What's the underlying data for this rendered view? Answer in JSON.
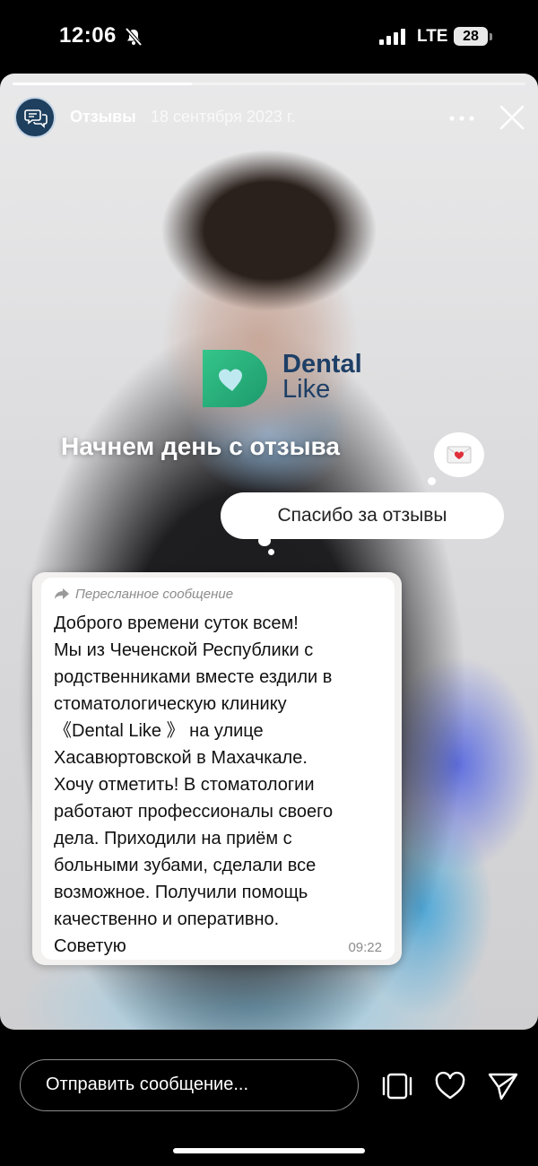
{
  "status_bar": {
    "time": "12:06",
    "network": "LTE",
    "battery": "28"
  },
  "story": {
    "progress": 0.35,
    "account": "Отзывы",
    "date": "18 сентября 2023 г.",
    "logo": {
      "line1": "Dental",
      "line2": "Like",
      "color": "#1e3f66",
      "mark_color": "#2fb37f"
    },
    "headline": "Начнем день с отзыва",
    "thanks_bubble": "Спасибо за отзывы",
    "message": {
      "forwarded_label": "Пересланное сообщение",
      "lines": [
        "Доброго времени суток всем!",
        "Мы из Чеченской Республики с",
        "родственниками вместе ездили в",
        "стоматологическую клинику",
        "《Dental Like 》 на улице",
        "Хасавюртовской в Махачкале.",
        "Хочу отметить! В стоматологии",
        "работают профессионалы своего",
        "дела. Приходили на приём с",
        "больными зубами, сделали все",
        "возможное. Получили помощь",
        "качественно и оперативно.",
        "Советую"
      ],
      "time": "09:22"
    }
  },
  "reply_bar": {
    "placeholder": "Отправить сообщение...",
    "icons": [
      "stories-icon",
      "heart-icon",
      "send-icon"
    ]
  }
}
